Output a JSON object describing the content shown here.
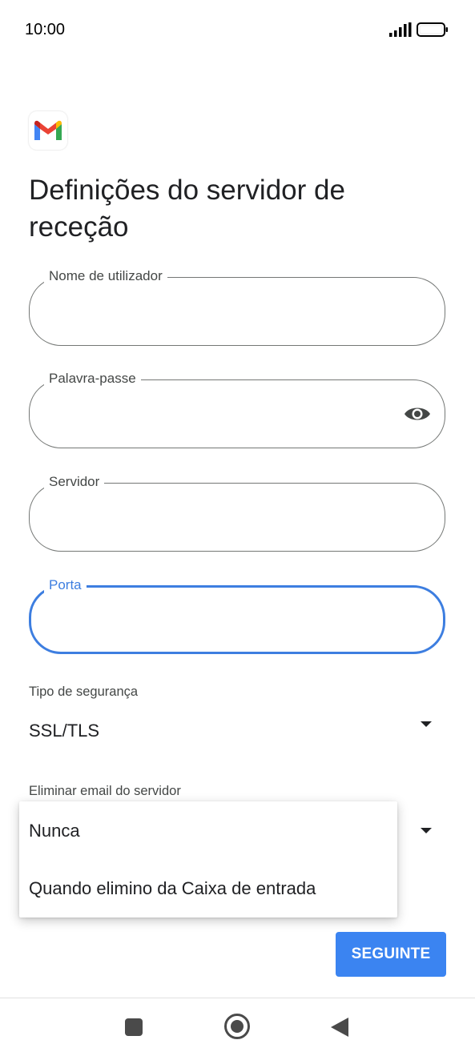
{
  "status_bar": {
    "time": "10:00"
  },
  "page": {
    "title": "Definições do servidor de receção"
  },
  "fields": {
    "username": {
      "label": "Nome de utilizador",
      "value": ""
    },
    "password": {
      "label": "Palavra-passe",
      "value": ""
    },
    "server": {
      "label": "Servidor",
      "value": ""
    },
    "port": {
      "label": "Porta",
      "value": ""
    }
  },
  "security": {
    "label": "Tipo de segurança",
    "value": "SSL/TLS"
  },
  "delete_email": {
    "label": "Eliminar email do servidor",
    "options": [
      "Nunca",
      "Quando elimino da Caixa de entrada"
    ]
  },
  "buttons": {
    "next": "SEGUINTE"
  },
  "colors": {
    "accent": "#3b84f1",
    "focus": "#3d7ee0",
    "border": "#747775"
  },
  "icons": [
    "signal-icon",
    "battery-icon",
    "gmail-logo-icon",
    "eye-icon",
    "caret-down-icon",
    "nav-recents-icon",
    "nav-home-icon",
    "nav-back-icon"
  ]
}
